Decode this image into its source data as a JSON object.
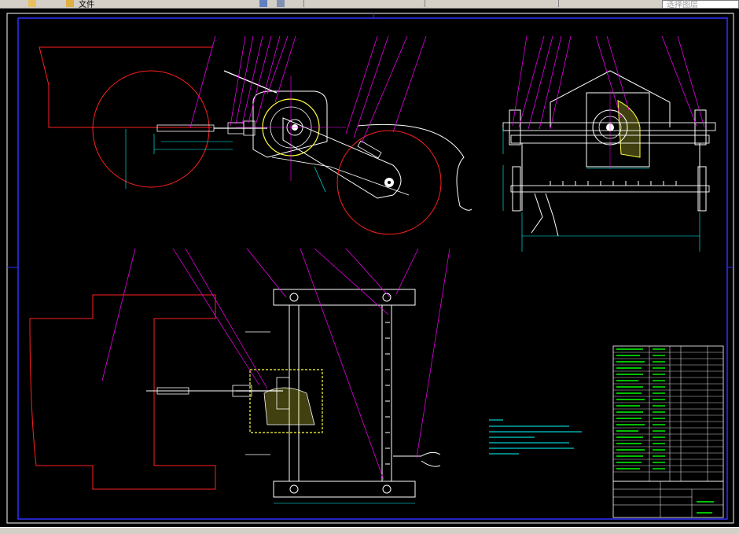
{
  "toolbar": {
    "menu_label": "文件",
    "tabs": [
      "",
      "",
      "",
      ""
    ],
    "right_box": "选择图层"
  },
  "colors": {
    "background": "#000000",
    "drawing": "#ffffff",
    "frame": "#2020ff",
    "leader": "#ff00ff",
    "dimension": "#00ffff",
    "contour": "#ff2020",
    "hatch": "#ffff40",
    "table_text": "#00ff00"
  }
}
